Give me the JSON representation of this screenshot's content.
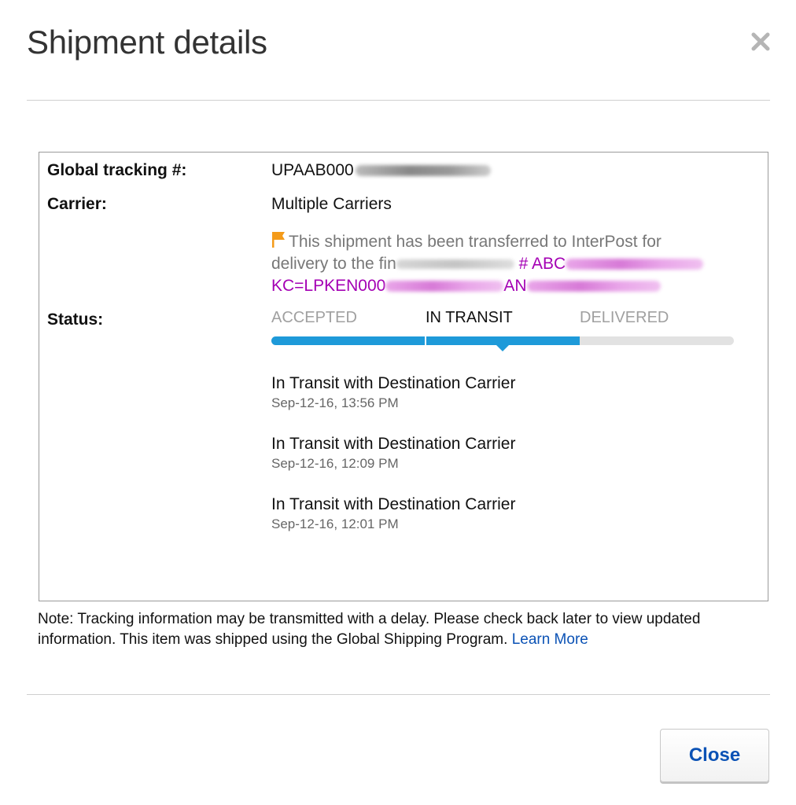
{
  "dialog": {
    "title": "Shipment details",
    "close_icon": "close-icon"
  },
  "details": {
    "tracking_label": "Global tracking #:",
    "tracking_value": "UPAAB000",
    "carrier_label": "Carrier:",
    "carrier_value": "Multiple Carriers",
    "notice": {
      "icon": "flag-icon",
      "text_line1": "This shipment has been transferred to InterPost for",
      "text_line2_prefix": "delivery to the fin",
      "link_line2": "# ABC",
      "link_line3_prefix": "KC=LPKEN000",
      "link_line3_suffix": "AN"
    },
    "status_label": "Status:",
    "stages": [
      "ACCEPTED",
      "IN TRANSIT",
      "DELIVERED"
    ],
    "progress_fraction": 0.667
  },
  "events": [
    {
      "title": "In Transit with Destination Carrier",
      "time": "Sep-12-16, 13:56 PM"
    },
    {
      "title": "In Transit with Destination Carrier",
      "time": "Sep-12-16, 12:09 PM"
    },
    {
      "title": "In Transit with Destination Carrier",
      "time": "Sep-12-16, 12:01 PM"
    }
  ],
  "note": {
    "text": "Note: Tracking information may be transmitted with a delay. Please check back later to view updated information. This item was shipped using the Global Shipping Program.",
    "link": "Learn More"
  },
  "footer": {
    "close_label": "Close"
  },
  "colors": {
    "accent": "#1e9ad9",
    "link": "#0b52b5",
    "notice_link": "#a400b4",
    "notice_flag": "#f49b1a"
  }
}
